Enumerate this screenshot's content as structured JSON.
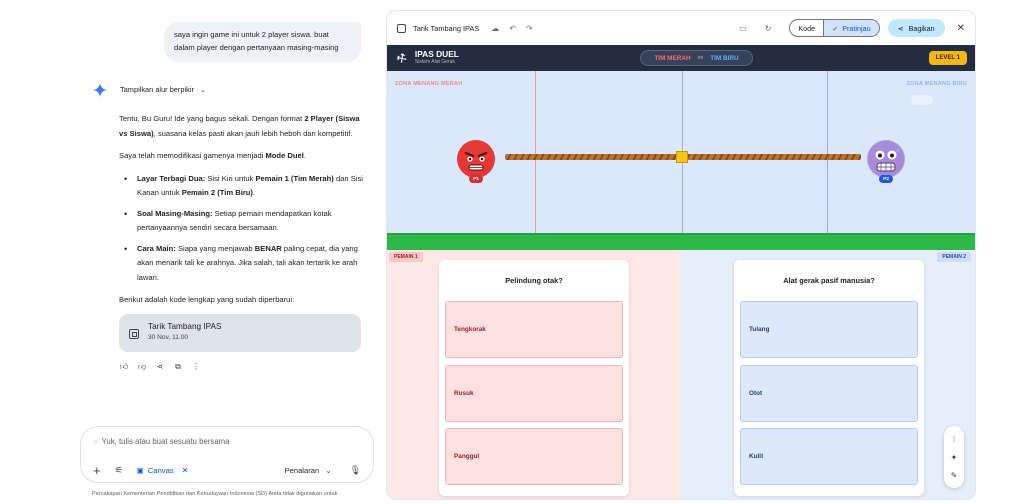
{
  "chat": {
    "user_message": "saya ingin game ini untuk 2 player siswa. buat dalam player dengan pertanyaan masing-masing",
    "thinking_label": "Tampilkan alur berpikir",
    "intro_a": "Tentu, Bu Guru! Ide yang bagus sekali. Dengan format ",
    "intro_b": "2 Player (Siswa vs Siswa)",
    "intro_c": ", suasana kelas pasti akan jauh lebih heboh dan kompetitif.",
    "modified_a": "Saya telah memodifikasi gamenya menjadi ",
    "modified_b": "Mode Duel",
    "modified_c": ".",
    "bullets": [
      {
        "head": "Layar Terbagi Dua:",
        "t1": " Sisi Kiri untuk ",
        "b1": "Pemain 1 (Tim Merah)",
        "t2": " dan Sisi Kanan untuk ",
        "b2": "Pemain 2 (Tim Biru)",
        "t3": "."
      },
      {
        "head": "Soal Masing-Masing:",
        "t1": " Setiap pemain mendapatkan kotak pertanyaannya sendiri secara bersamaan.",
        "b1": "",
        "t2": "",
        "b2": "",
        "t3": ""
      },
      {
        "head": "Cara Main:",
        "t1": " Siapa yang menjawab ",
        "b1": "BENAR",
        "t2": " paling cepat, dia yang akan menarik tali ke arahnya. Jika salah, tali akan tertarik ke arah lawan.",
        "b2": "",
        "t3": ""
      }
    ],
    "code_intro": "Berikut adalah kode lengkap yang sudah diperbarui:",
    "canvas_card": {
      "title": "Tarik Tambang IPAS",
      "date": "30 Nov, 11.00"
    },
    "composer": {
      "placeholder": "Yuk, tulis atau buat sesuatu bersama",
      "canvas_chip": "Canvas",
      "reasoning": "Penalaran"
    },
    "disclaimer": "Percakapan Kementerian Pendidikan dan Kebudayaan Indonesia (SD) Anda tidak digunakan untuk"
  },
  "canvas": {
    "title": "Tarik Tambang IPAS",
    "mode_code": "Kode",
    "mode_preview": "Pratinjau",
    "share": "Bagikan"
  },
  "game": {
    "title": "IPAS DUEL",
    "subtitle": "Sistem Alat Gerak",
    "team_red": "TIM MERAH",
    "vs": "vs",
    "team_blue": "TIM BIRU",
    "level": "LEVEL 1",
    "zone_red": "ZONA MENANG MERAH",
    "zone_blue": "ZONA MENANG BIRU",
    "p1_badge": "P1",
    "p2_badge": "P2",
    "player1": {
      "tag": "PEMAIN 1",
      "question": "Pelindung otak?",
      "options": [
        "Tengkorak",
        "Rusuk",
        "Panggul"
      ]
    },
    "player2": {
      "tag": "PEMAIN 2",
      "question": "Alat gerak pasif manusia?",
      "options": [
        "Tulang",
        "Otot",
        "Kulit"
      ]
    }
  },
  "colors": {
    "red_team": "#e53935",
    "blue_team": "#1e5bd6",
    "header_bg": "#232d3f",
    "level_badge": "#f2b61b",
    "grass": "#2fb84a"
  }
}
